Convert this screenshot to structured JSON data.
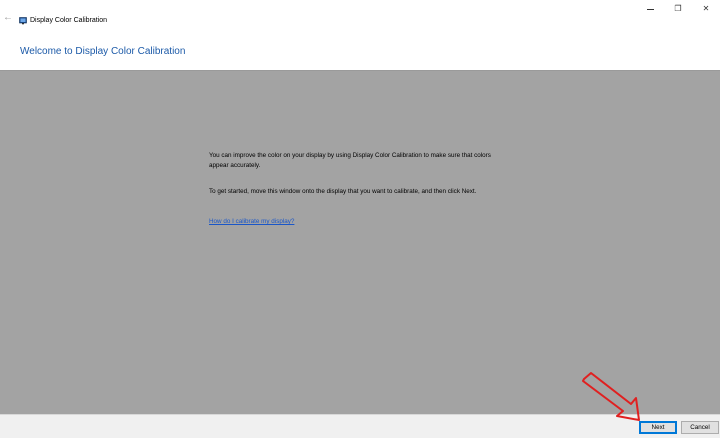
{
  "window": {
    "title": "Display Color Calibration",
    "controls": {
      "minimize": "",
      "restore": "❐",
      "close": "✕"
    }
  },
  "nav": {
    "back_icon": "←"
  },
  "page": {
    "heading": "Welcome to Display Color Calibration",
    "paragraph_1": "You can improve the color on your display by using Display Color Calibration to make sure that colors appear accurately.",
    "paragraph_2": "To get started, move this window onto the display that you want to calibrate, and then click Next.",
    "help_link": "How do I calibrate my display?"
  },
  "footer": {
    "next_label": "Next",
    "cancel_label": "Cancel"
  },
  "colors": {
    "heading": "#1c5aa8",
    "link": "#1a56c8",
    "content_bg": "#a3a3a3",
    "annotation_arrow": "#e02020"
  },
  "icons": {
    "back": "back-arrow-icon",
    "app": "display-calibration-icon",
    "annotation": "annotation-arrow-icon"
  }
}
